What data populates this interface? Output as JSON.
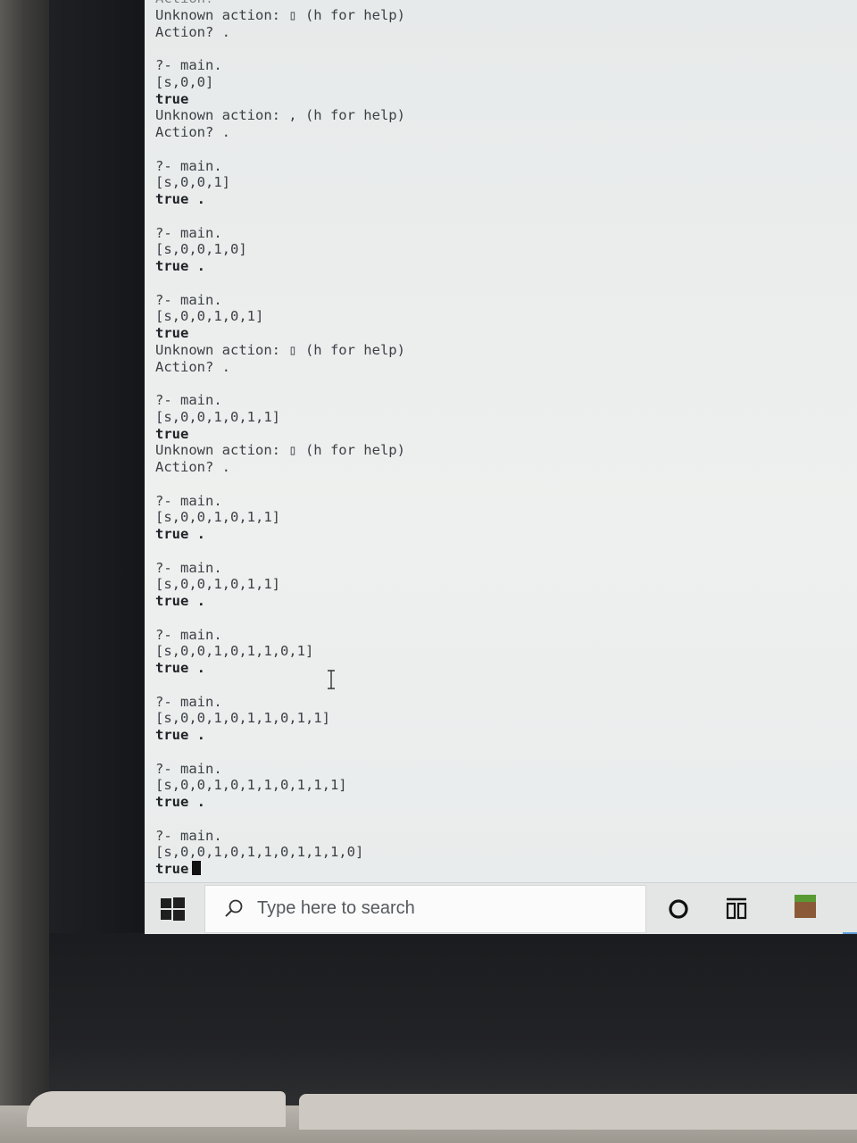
{
  "terminal": {
    "lines": [
      {
        "text": "Action?",
        "style": "faint"
      },
      {
        "text": "Unknown action: ▯ (h for help)",
        "style": "normal"
      },
      {
        "text": "Action? .",
        "style": "normal"
      },
      {
        "text": "",
        "style": "normal"
      },
      {
        "text": "?- main.",
        "style": "normal"
      },
      {
        "text": "[s,0,0]",
        "style": "normal"
      },
      {
        "text": "true",
        "style": "bold"
      },
      {
        "text": "Unknown action: , (h for help)",
        "style": "normal"
      },
      {
        "text": "Action? .",
        "style": "normal"
      },
      {
        "text": "",
        "style": "normal"
      },
      {
        "text": "?- main.",
        "style": "normal"
      },
      {
        "text": "[s,0,0,1]",
        "style": "normal"
      },
      {
        "text": "true .",
        "style": "bold"
      },
      {
        "text": "",
        "style": "normal"
      },
      {
        "text": "?- main.",
        "style": "normal"
      },
      {
        "text": "[s,0,0,1,0]",
        "style": "normal"
      },
      {
        "text": "true .",
        "style": "bold"
      },
      {
        "text": "",
        "style": "normal"
      },
      {
        "text": "?- main.",
        "style": "normal"
      },
      {
        "text": "[s,0,0,1,0,1]",
        "style": "normal"
      },
      {
        "text": "true",
        "style": "bold"
      },
      {
        "text": "Unknown action: ▯ (h for help)",
        "style": "normal"
      },
      {
        "text": "Action? .",
        "style": "normal"
      },
      {
        "text": "",
        "style": "normal"
      },
      {
        "text": "?- main.",
        "style": "normal"
      },
      {
        "text": "[s,0,0,1,0,1,1]",
        "style": "normal"
      },
      {
        "text": "true",
        "style": "bold"
      },
      {
        "text": "Unknown action: ▯ (h for help)",
        "style": "normal"
      },
      {
        "text": "Action? .",
        "style": "normal"
      },
      {
        "text": "",
        "style": "normal"
      },
      {
        "text": "?- main.",
        "style": "normal"
      },
      {
        "text": "[s,0,0,1,0,1,1]",
        "style": "normal"
      },
      {
        "text": "true .",
        "style": "bold"
      },
      {
        "text": "",
        "style": "normal"
      },
      {
        "text": "?- main.",
        "style": "normal"
      },
      {
        "text": "[s,0,0,1,0,1,1]",
        "style": "normal"
      },
      {
        "text": "true .",
        "style": "bold"
      },
      {
        "text": "",
        "style": "normal"
      },
      {
        "text": "?- main.",
        "style": "normal"
      },
      {
        "text": "[s,0,0,1,0,1,1,0,1]",
        "style": "normal"
      },
      {
        "text": "true .",
        "style": "bold"
      },
      {
        "text": "",
        "style": "normal"
      },
      {
        "text": "?- main.",
        "style": "normal"
      },
      {
        "text": "[s,0,0,1,0,1,1,0,1,1]",
        "style": "normal"
      },
      {
        "text": "true .",
        "style": "bold"
      },
      {
        "text": "",
        "style": "normal"
      },
      {
        "text": "?- main.",
        "style": "normal"
      },
      {
        "text": "[s,0,0,1,0,1,1,0,1,1,1]",
        "style": "normal"
      },
      {
        "text": "true .",
        "style": "bold"
      },
      {
        "text": "",
        "style": "normal"
      },
      {
        "text": "?- main.",
        "style": "normal"
      },
      {
        "text": "[s,0,0,1,0,1,1,0,1,1,1,0]",
        "style": "normal"
      },
      {
        "text": "true",
        "style": "bold",
        "cursor": true
      }
    ]
  },
  "taskbar": {
    "search_placeholder": "Type here to search",
    "icons": [
      "windows-start-icon",
      "search-icon",
      "cortana-icon",
      "task-view-icon",
      "minecraft-app-icon"
    ],
    "accent_color": "#5b9bd5"
  }
}
